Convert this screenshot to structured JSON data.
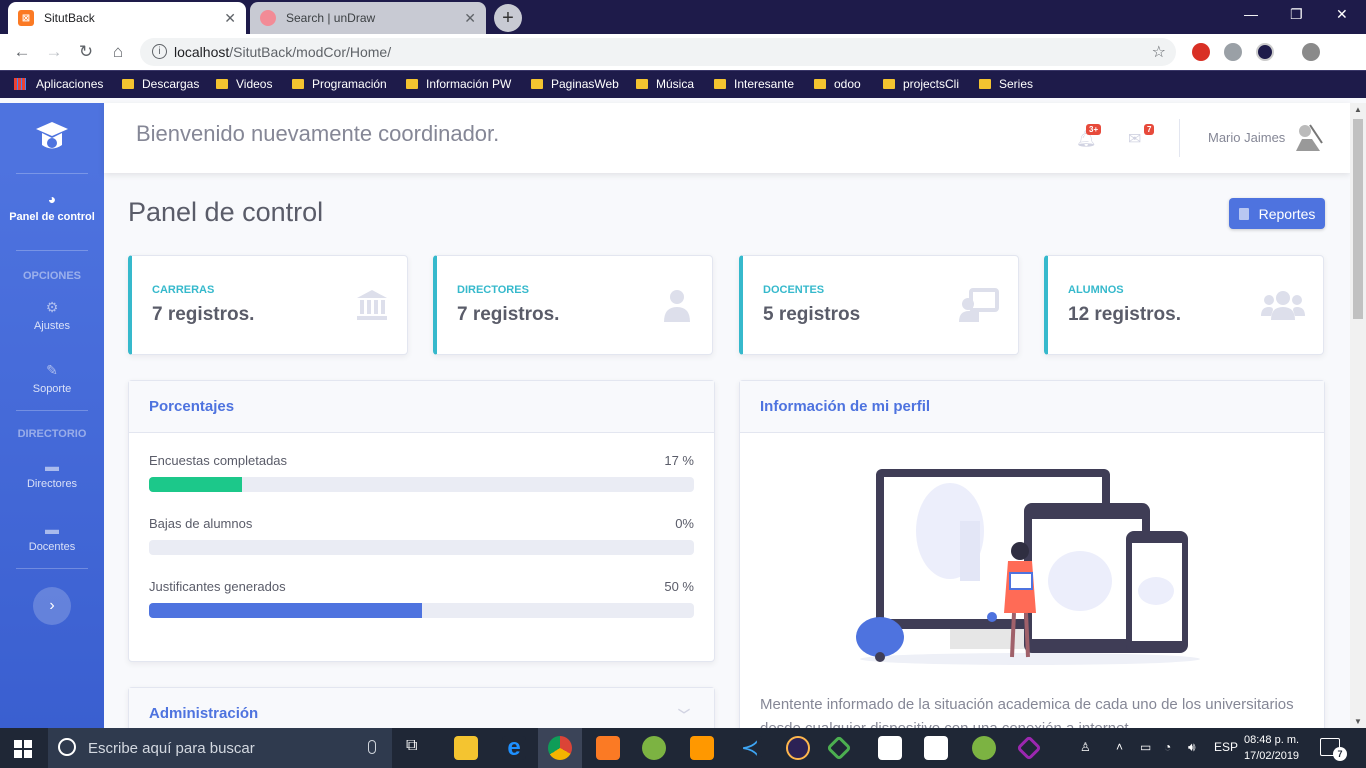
{
  "browser": {
    "tabs": [
      {
        "title": "SitutBack",
        "active": true
      },
      {
        "title": "Search | unDraw",
        "active": false
      }
    ],
    "url_host": "localhost",
    "url_path": "/SitutBack/modCor/Home/",
    "bookmarks": [
      "Aplicaciones",
      "Descargas",
      "Videos",
      "Programación",
      "Información PW",
      "PaginasWeb",
      "Música",
      "Interesante",
      "odoo",
      "projectsCli",
      "Series"
    ]
  },
  "sidebar": {
    "active_item": "Panel de control",
    "heading_options": "OPCIONES",
    "heading_directory": "DIRECTORIO",
    "items": {
      "ajustes": "Ajustes",
      "soporte": "Soporte",
      "directores": "Directores",
      "docentes": "Docentes"
    },
    "toggle_icon": "chevron-right"
  },
  "topbar": {
    "welcome": "Bienvenido nuevamente coordinador.",
    "alerts_badge": "3+",
    "messages_badge": "7",
    "user_name": "Mario Jaimes"
  },
  "page": {
    "title": "Panel de control",
    "report_button": "Reportes"
  },
  "stats": [
    {
      "label": "CARRERAS",
      "value": "7 registros.",
      "icon": "university-icon"
    },
    {
      "label": "DIRECTORES",
      "value": "7 registros.",
      "icon": "user-tie-icon"
    },
    {
      "label": "DOCENTES",
      "value": "5 registros",
      "icon": "chalkboard-teacher-icon"
    },
    {
      "label": "ALUMNOS",
      "value": "12 registros.",
      "icon": "users-icon"
    }
  ],
  "percentages": {
    "title": "Porcentajes",
    "rows": [
      {
        "label": "Encuestas completadas",
        "value_text": "17 %",
        "percent": 17,
        "color": "#1cc88a"
      },
      {
        "label": "Bajas de alumnos",
        "value_text": "0%",
        "percent": 0,
        "color": "#e74a3b"
      },
      {
        "label": "Justificantes generados",
        "value_text": "50 %",
        "percent": 50,
        "color": "#4e73df"
      }
    ]
  },
  "admin": {
    "title": "Administración"
  },
  "profile": {
    "title": "Información de mi perfil",
    "text": "Mentente informado de la situación academica de cada uno de los universitarios desde cualquier dispositivo con una conexión a internet."
  },
  "taskbar": {
    "search_placeholder": "Escribe aquí para buscar",
    "language": "ESP",
    "time": "08:48 p. m.",
    "date": "17/02/2019",
    "notifications": "7"
  },
  "colors": {
    "primary": "#4e73df",
    "info": "#36b9cc",
    "success": "#1cc88a",
    "browser_frame": "#1e1b4a"
  }
}
